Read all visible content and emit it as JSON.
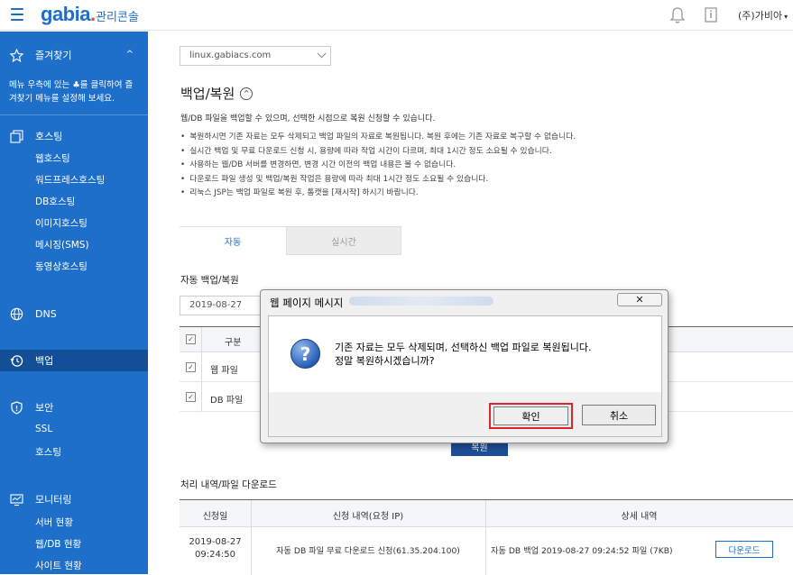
{
  "topbar": {
    "logo": "gabia",
    "logo_dot": ".",
    "console_title": "관리콘솔",
    "user_label": "(주)가비아",
    "caret": "▾"
  },
  "sidebar": {
    "favorites": {
      "label": "즐겨찾기",
      "chevron": "^",
      "desc_line1": "메뉴 우측에 있는 ♣를 클릭하여 즐",
      "desc_line2": "겨찾기 메뉴를 설정해 보세요."
    },
    "hosting": {
      "label": "호스팅",
      "subs": [
        "웹호스팅",
        "워드프레스호스팅",
        "DB호스팅",
        "이미지호스팅",
        "메시징(SMS)",
        "동영상호스팅"
      ]
    },
    "dns": {
      "label": "DNS"
    },
    "backup": {
      "label": "백업"
    },
    "security": {
      "label": "보안",
      "subs": [
        "SSL",
        "호스팅"
      ]
    },
    "monitoring": {
      "label": "모니터링",
      "subs": [
        "서버 현황",
        "웹/DB 현황",
        "사이트 현황"
      ]
    }
  },
  "main": {
    "domain_select": "linux.gabiacs.com",
    "heading": "백업/복원",
    "heading_toggle": "^",
    "intro": "웹/DB 파일을 백업할 수 있으며, 선택한 시점으로 복원 신청할 수 있습니다.",
    "bullets": [
      "복원하시면 기존 자료는 모두 삭제되고 백업 파일의 자료로 복원됩니다. 복원 후에는 기존 자료로 복구할 수 없습니다.",
      "실시간 백업 및 무료 다운로드 신청 시, 용량에 따라 작업 시간이 다르며, 최대 1시간 정도 소요될 수 있습니다.",
      "사용하는 웹/DB 서버를 변경하면, 변경 시간 이전의 백업 내용은 볼 수 없습니다.",
      "다운로드 파일 생성 및 백업/복원 작업은 용량에 따라 최대 1시간 정도 소요될 수 있습니다.",
      "리눅스 JSP는 백업 파일로 복원 후, 톰캣을 [재시작] 하시기 바랍니다."
    ],
    "tabs": [
      "자동",
      "실시간"
    ],
    "auto_title": "자동 백업/복원",
    "date": "2019-08-27",
    "table1": {
      "header": "구분",
      "rows": [
        "웹 파일",
        "DB 파일"
      ],
      "check": "✓"
    },
    "restore_button": "복원",
    "history_title": "처리 내역/파일 다운로드",
    "table2": {
      "headers": [
        "신청일",
        "신청 내역(요청 IP)",
        "상세 내역"
      ],
      "row": {
        "date": "2019-08-27",
        "time": "09:24:50",
        "request": "자동 DB 파일 무료 다운로드 신청(61.35.204.100)",
        "detail": "자동 DB 백업 2019-08-27 09:24:52 파일 (7KB)",
        "download": "다운로드"
      }
    }
  },
  "dialog": {
    "title": "웹 페이지 메시지",
    "close": "✕",
    "icon": "?",
    "message_line1": "기존 자료는 모두 삭제되며, 선택하신 백업 파일로 복원됩니다.",
    "message_line2": "정말 복원하시겠습니까?",
    "ok": "확인",
    "cancel": "취소"
  },
  "colors": {
    "brand": "#1e6fc9",
    "sidebar_active": "#134f96",
    "highlight": "#d8262b"
  },
  "icons": [
    "menu-icon",
    "bell-icon",
    "document-icon",
    "star-icon",
    "hosting-icon",
    "globe-icon",
    "clock-icon",
    "shield-icon",
    "monitor-icon",
    "question-icon"
  ]
}
